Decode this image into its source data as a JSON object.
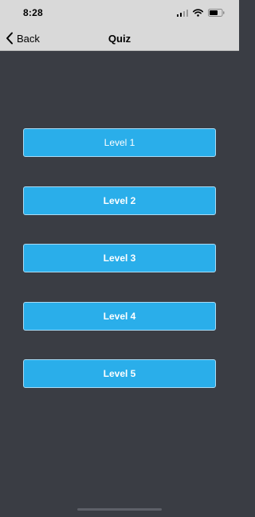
{
  "status_bar": {
    "time": "8:28",
    "icons": [
      "cellular-signal-icon",
      "wifi-icon",
      "battery-icon"
    ]
  },
  "nav": {
    "back_label": "Back",
    "title": "Quiz"
  },
  "levels": [
    {
      "label": "Level 1"
    },
    {
      "label": "Level 2"
    },
    {
      "label": "Level 3"
    },
    {
      "label": "Level 4"
    },
    {
      "label": "Level 5"
    }
  ],
  "colors": {
    "background": "#3a3d44",
    "bar": "#d9d9d9",
    "button": "#2aaeea",
    "button_text": "#ffffff"
  }
}
